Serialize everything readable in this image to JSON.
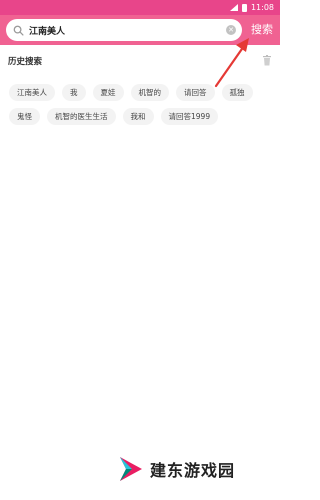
{
  "status_bar": {
    "time": "11:08"
  },
  "search": {
    "query": "江南美人",
    "button_label": "搜索"
  },
  "history": {
    "title": "历史搜索",
    "rows": [
      [
        "江南美人",
        "我",
        "夏娃",
        "机智的",
        "请回答",
        "孤独"
      ],
      [
        "鬼怪",
        "机智的医生生活",
        "我和",
        "请回答1999"
      ]
    ]
  },
  "watermark": {
    "text": "建东游戏园"
  },
  "colors": {
    "status_bar": "#e8458a",
    "header": "#f06292",
    "tag_bg": "#f3f3f3",
    "arrow": "#e53935"
  },
  "icons": {
    "search": "search-icon",
    "clear": "clear-icon",
    "trash": "trash-icon",
    "signal": "signal-icon",
    "battery": "battery-icon"
  }
}
